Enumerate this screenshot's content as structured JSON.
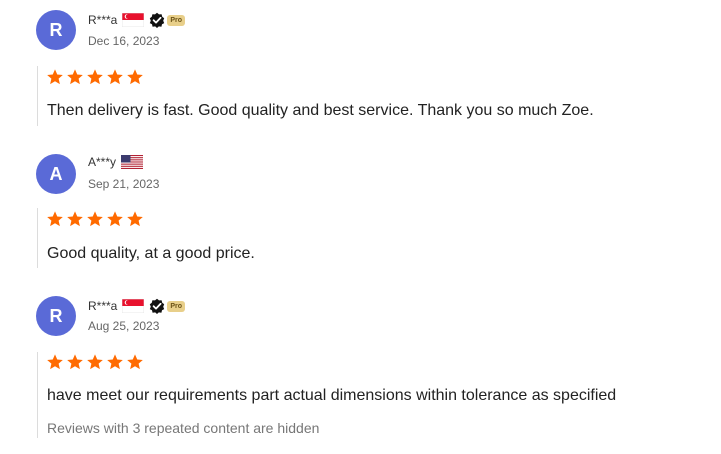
{
  "reviews": [
    {
      "initial": "R",
      "name": "R***a",
      "country": "SG",
      "pro": true,
      "pro_label": "Pro",
      "date": "Dec 16, 2023",
      "rating": 5,
      "text": "Then delivery is fast. Good quality and best service. Thank you so much Zoe."
    },
    {
      "initial": "A",
      "name": "A***y",
      "country": "US",
      "pro": false,
      "date": "Sep 21, 2023",
      "rating": 5,
      "text": "Good quality, at a good price."
    },
    {
      "initial": "R",
      "name": "R***a",
      "country": "SG",
      "pro": true,
      "pro_label": "Pro",
      "date": "Aug 25, 2023",
      "rating": 5,
      "text": "have meet our requirements part actual dimensions within tolerance as specified"
    }
  ],
  "hidden_note": "Reviews with 3 repeated content are hidden",
  "colors": {
    "avatar": "#5a6ad7",
    "star": "#ff6a00",
    "pro_badge": "#e8cf8a"
  },
  "icons": [
    "singapore-flag-icon",
    "usa-flag-icon",
    "verified-check-icon",
    "star-icon"
  ]
}
